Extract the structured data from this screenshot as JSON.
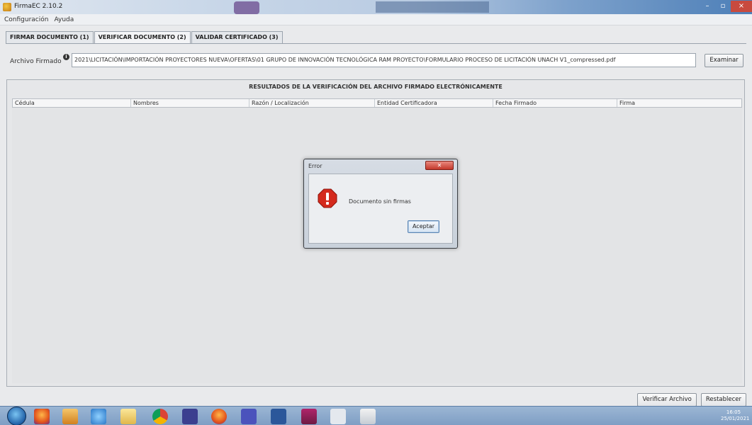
{
  "window": {
    "title": "FirmaEC 2.10.2",
    "controls": [
      "–",
      "▫",
      "×"
    ]
  },
  "menu": {
    "items": [
      "Configuración",
      "Ayuda"
    ]
  },
  "tabs": [
    {
      "label": "FIRMAR DOCUMENTO (1)",
      "active": false
    },
    {
      "label": "VERIFICAR DOCUMENTO (2)",
      "active": true
    },
    {
      "label": "VALIDAR CERTIFICADO (3)",
      "active": false
    }
  ],
  "signed_file": {
    "label": "Archivo Firmado",
    "info_icon": "i",
    "value": "2021\\LICITACIÓN\\IMPORTACIÓN PROYECTORES NUEVA\\OFERTAS\\01 GRUPO DE INNOVACIÓN TECNOLÓGICA RAM PROYECTO\\FORMULARIO PROCESO DE LICITACIÓN UNACH V1_compressed.pdf",
    "examine_button": "Examinar"
  },
  "results": {
    "title": "RESULTADOS DE LA VERIFICACIÓN DEL ARCHIVO FIRMADO ELECTRÓNICAMENTE",
    "columns": [
      "Cédula",
      "Nombres",
      "Razón / Localización",
      "Entidad Certificadora",
      "Fecha Firmado",
      "Firma"
    ]
  },
  "dialog": {
    "title": "Error",
    "close_label": "✕",
    "icon": "error-icon",
    "message": "Documento sin firmas",
    "ok_button": "Aceptar"
  },
  "actions": {
    "verify_button": "Verificar Archivo",
    "reset_button": "Restablecer"
  },
  "taskbar": {
    "apps": [
      "firefox-icon",
      "media-player-icon",
      "internet-explorer-icon",
      "folder-icon",
      "chrome-icon",
      "chrome-alt-icon",
      "firefox-alt-icon",
      "teams-icon",
      "word-icon",
      "winrar-icon",
      "notepad-icon",
      "firmaec-icon"
    ],
    "clock_time": "16:05",
    "clock_date": "25/01/2021"
  }
}
